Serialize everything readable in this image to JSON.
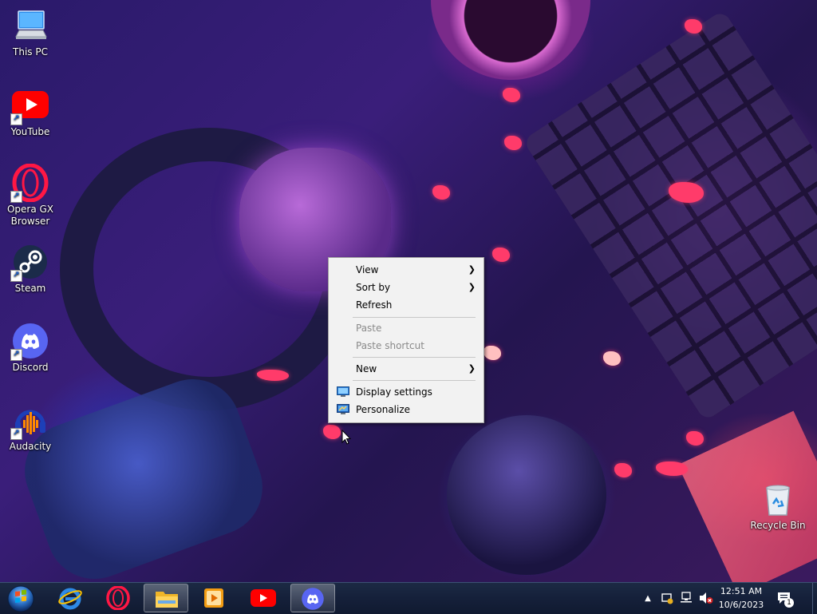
{
  "desktop": {
    "icons": [
      {
        "label": "This PC"
      },
      {
        "label": "YouTube"
      },
      {
        "label": "Opera GX Browser"
      },
      {
        "label": "Steam"
      },
      {
        "label": "Discord"
      },
      {
        "label": "Audacity"
      },
      {
        "label": "Recycle Bin"
      }
    ]
  },
  "context_menu": {
    "items": [
      {
        "label": "View",
        "enabled": true,
        "submenu": true
      },
      {
        "label": "Sort by",
        "enabled": true,
        "submenu": true
      },
      {
        "label": "Refresh",
        "enabled": true,
        "submenu": false
      },
      {
        "label": "Paste",
        "enabled": false,
        "submenu": false
      },
      {
        "label": "Paste shortcut",
        "enabled": false,
        "submenu": false
      },
      {
        "label": "New",
        "enabled": true,
        "submenu": true
      },
      {
        "label": "Display settings",
        "enabled": true,
        "submenu": false,
        "icon": "display-icon"
      },
      {
        "label": "Personalize",
        "enabled": true,
        "submenu": false,
        "icon": "personalize-icon"
      }
    ],
    "submenu_arrow": "❯"
  },
  "taskbar": {
    "apps": [
      {
        "name": "internet-explorer"
      },
      {
        "name": "opera"
      },
      {
        "name": "file-explorer",
        "active": true
      },
      {
        "name": "media-player"
      },
      {
        "name": "youtube"
      },
      {
        "name": "discord",
        "active": true
      }
    ],
    "tray": {
      "overflow_arrow": "▲",
      "time": "12:51 AM",
      "date": "10/6/2023",
      "notification_count": "1"
    }
  },
  "colors": {
    "menu_bg": "#f2f2f2",
    "taskbar_bg": "#15203a",
    "youtube_red": "#ff0000",
    "discord_blurple": "#5865f2"
  }
}
